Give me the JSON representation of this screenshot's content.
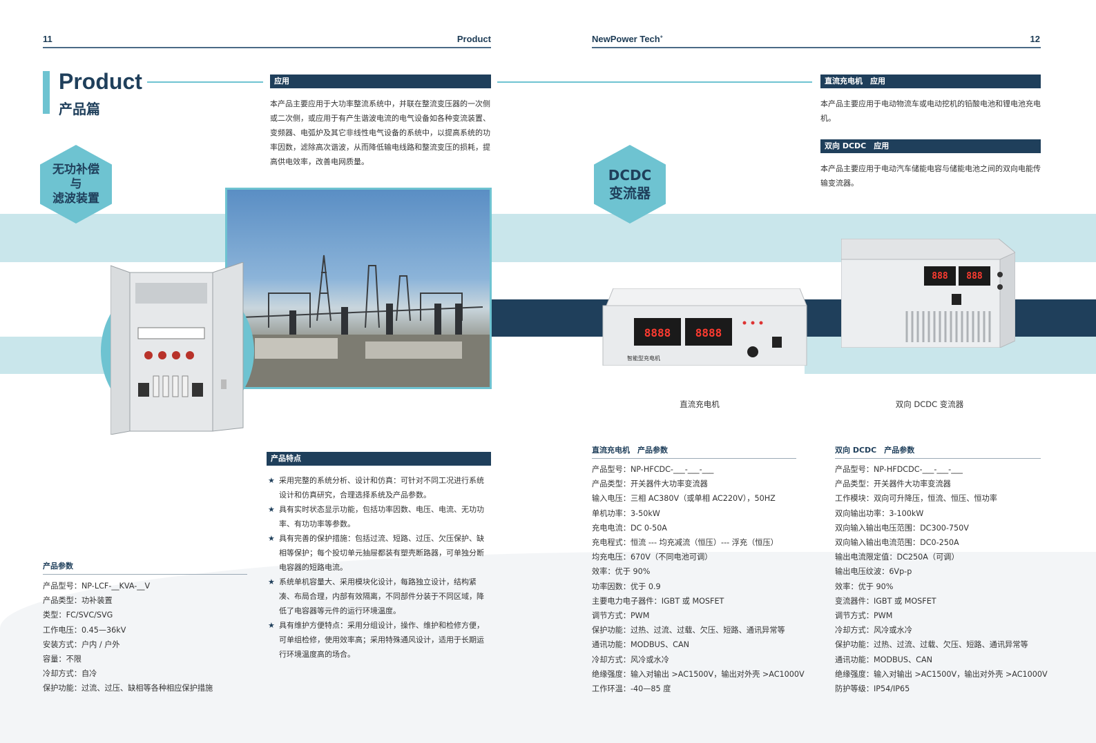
{
  "header": {
    "left_page": "11",
    "left_title": "Product",
    "right_brand": "NewPower Tech",
    "right_page": "12"
  },
  "left": {
    "title_en": "Product",
    "title_cn": "产品篇",
    "hex_label_1": "无功补偿",
    "hex_label_2": "与",
    "hex_label_3": "滤波装置",
    "application": {
      "heading": "应用",
      "text": "本产品主要应用于大功率整流系统中，并联在整流变压器的一次侧或二次侧，或应用于有产生谐波电流的电气设备如各种变流装置、变频器、电弧炉及其它非线性电气设备的系统中，以提高系统的功率因数，滤除高次谐波，从而降低输电线路和整流变压的损耗，提高供电效率，改善电网质量。"
    },
    "features": {
      "heading": "产品特点",
      "items": [
        "采用完整的系统分析、设计和仿真：可针对不同工况进行系统设计和仿真研究，合理选择系统及产品参数。",
        "具有实时状态显示功能，包括功率因数、电压、电流、无功功率、有功功率等参数。",
        "具有完善的保护措施：包括过流、短路、过压、欠压保护、缺相等保护；每个投切单元抽屉都装有塑壳断路器，可单独分断电容器的短路电流。",
        "系统单机容量大、采用模块化设计，每路独立设计，结构紧凑、布局合理，内部有效隔离，不同部件分装于不同区域，降低了电容器等元件的运行环境温度。",
        "具有维护方便特点：采用分组设计，操作、维护和检修方便，可单组检修，使用效率高；采用特殊通风设计，适用于长期运行环境温度高的场合。"
      ]
    },
    "params": {
      "heading": "产品参数",
      "items": [
        "产品型号：NP-LCF-__KVA-__V",
        "产品类型：功补装置",
        "类型：FC/SVC/SVG",
        "工作电压：0.45—36kV",
        "安装方式：户内 / 户外",
        "容量：不限",
        "冷却方式：自冷",
        "保护功能：过流、过压、缺相等各种相应保护措施"
      ]
    }
  },
  "right": {
    "hex_label_1": "DCDC",
    "hex_label_2": "变流器",
    "dc_app": {
      "heading": "直流充电机　应用",
      "text": "本产品主要应用于电动物流车或电动挖机的铅酸电池和锂电池充电机。"
    },
    "bidi_app": {
      "heading": "双向 DCDC　应用",
      "text": "本产品主要应用于电动汽车储能电容与储能电池之间的双向电能传输变流器。"
    },
    "caption_charger": "直流充电机",
    "caption_dcdc": "双向 DCDC 变流器",
    "charger_panel": {
      "disp1": "8888",
      "disp2": "8888",
      "brand": "智能型充电机"
    },
    "dcdc_panel": {
      "disp1": "888",
      "disp2": "888"
    },
    "dc_params": {
      "heading": "直流充电机　产品参数",
      "items": [
        "产品型号：NP-HFCDC-___-___-___",
        "产品类型：开关器件大功率变流器",
        "输入电压：三相 AC380V（或单相 AC220V），50HZ",
        "单机功率：3-50kW",
        "充电电流：DC 0-50A",
        "充电程式：恒流 --- 均充减流（恒压）--- 浮充（恒压）",
        "均充电压：670V（不同电池可调）",
        "效率：优于 90%",
        "功率因数：优于 0.9",
        "主要电力电子器件：IGBT 或 MOSFET",
        "调节方式：PWM",
        "保护功能：过热、过流、过载、欠压、短路、通讯异常等",
        "通讯功能：MODBUS、CAN",
        "冷却方式：风冷或水冷",
        "绝缘强度：输入对输出 >AC1500V，输出对外壳 >AC1000V",
        "工作环温：-40—85 度"
      ]
    },
    "bidi_params": {
      "heading": "双向 DCDC　产品参数",
      "items": [
        "产品型号：NP-HFDCDC-___-___-___",
        "产品类型：开关器件大功率变流器",
        "工作模块：双向可升降压，恒流、恒压、恒功率",
        "双向输出功率：3-100kW",
        "双向输入输出电压范围：DC300-750V",
        "双向输入输出电流范围：DC0-250A",
        "输出电流限定值：DC250A（可调）",
        "输出电压纹波：6Vp-p",
        "效率：优于 90%",
        "变流器件：IGBT 或 MOSFET",
        "调节方式：PWM",
        "冷却方式：风冷或水冷",
        "保护功能：过热、过流、过载、欠压、短路、通讯异常等",
        "通讯功能：MODBUS、CAN",
        "绝缘强度：输入对输出 >AC1500V，输出对外壳 >AC1000V",
        "防护等级：IP54/IP65"
      ]
    }
  },
  "colors": {
    "navy": "#1f3f5b",
    "teal": "#6ec3d1",
    "light_band": "#c9e6eb"
  }
}
